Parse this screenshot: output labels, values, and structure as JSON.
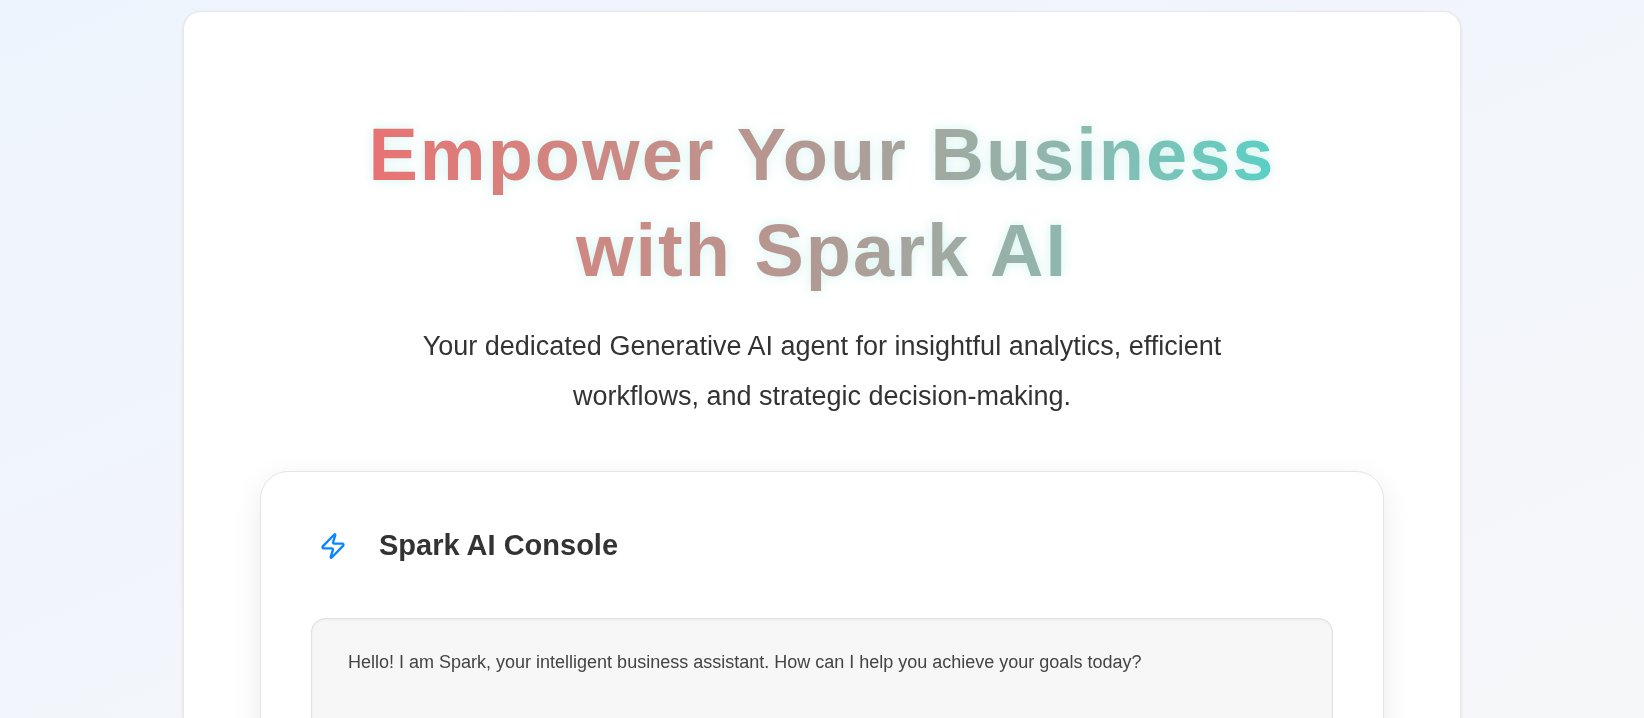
{
  "hero": {
    "title": "Empower Your Business with Spark AI",
    "subtitle": "Your dedicated Generative AI agent for insightful analytics, efficient workflows, and strategic decision-making."
  },
  "console": {
    "title": "Spark AI Console",
    "messages": [
      {
        "text": "Hello! I am Spark, your intelligent business assistant. How can I help you achieve your goals today?"
      }
    ]
  }
}
